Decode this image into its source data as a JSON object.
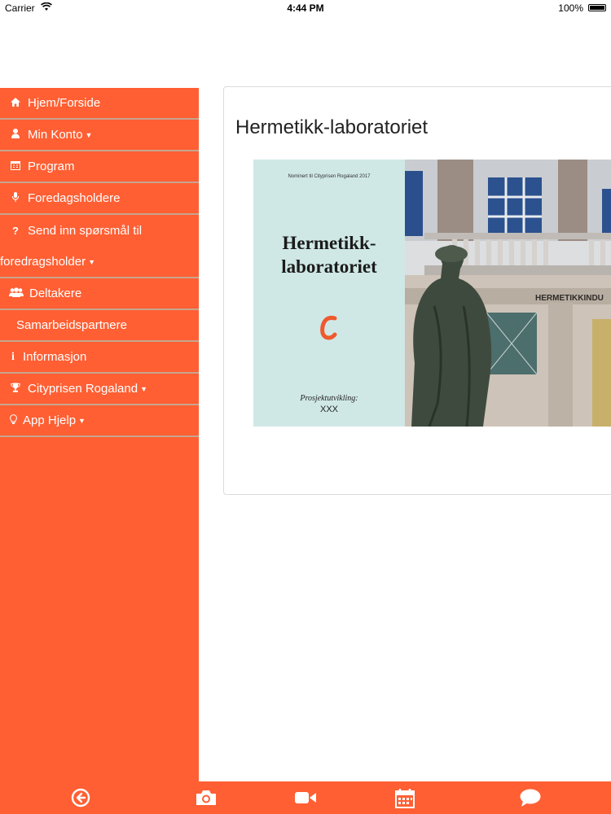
{
  "status_bar": {
    "carrier": "Carrier",
    "time": "4:44 PM",
    "battery": "100%"
  },
  "sidebar": {
    "items": [
      {
        "label": "Hjem/Forside",
        "icon": "home-icon"
      },
      {
        "label": "Min Konto",
        "icon": "user-icon",
        "dropdown": true
      },
      {
        "label": "Program",
        "icon": "calendar-icon"
      },
      {
        "label": "Foredagsholdere",
        "icon": "microphone-icon"
      },
      {
        "label": "Send inn spørsmål til",
        "label2": "foredragsholder",
        "icon": "question-icon",
        "dropdown": true
      },
      {
        "label": "Deltakere",
        "icon": "users-icon"
      },
      {
        "label": "Samarbeidspartnere",
        "icon": ""
      },
      {
        "label": "Informasjon",
        "icon": "info-icon"
      },
      {
        "label": "Cityprisen Rogaland",
        "icon": "trophy-icon",
        "dropdown": true
      },
      {
        "label": "App Hjelp",
        "icon": "lightbulb-icon",
        "dropdown": true
      }
    ]
  },
  "main": {
    "title": "Hermetikk-laboratoriet",
    "hero": {
      "nominated": "Nominert til Cityprisen Rogaland 2017",
      "heading_line1": "Hermetikk-",
      "heading_line2": "laboratoriet",
      "subtitle": "Prosjektutvikling:",
      "code": "XXX",
      "building_sign": "HERMETIKKINDU"
    }
  },
  "toolbar": {
    "icons": [
      "back-icon",
      "camera-icon",
      "video-icon",
      "calendar-icon",
      "chat-icon"
    ]
  },
  "colors": {
    "accent": "#ff5f33",
    "hero_panel": "#cfe8e6",
    "logo": "#ee5a2e"
  }
}
